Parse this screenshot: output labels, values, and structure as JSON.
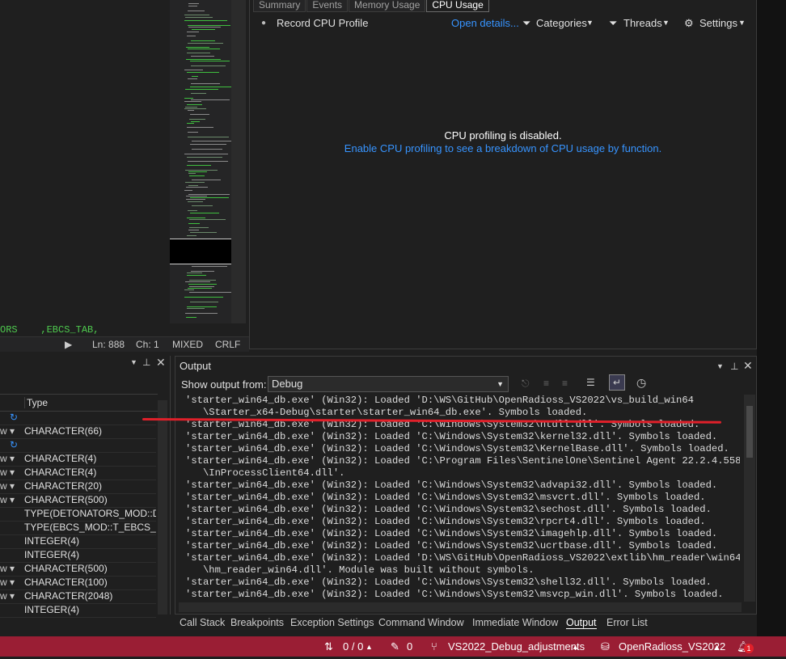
{
  "editor": {
    "code_snippet": "ORS    ,EBCS_TAB,",
    "status": {
      "ln": "Ln: 888",
      "ch": "Ch: 1",
      "indent": "MIXED",
      "eol": "CRLF"
    }
  },
  "diagnostics": {
    "tabs": [
      "Summary",
      "Events",
      "Memory Usage",
      "CPU Usage"
    ],
    "active_tab": "CPU Usage",
    "toolbar": {
      "record": "Record CPU Profile",
      "open_details": "Open details...",
      "categories": "Categories",
      "threads": "Threads",
      "settings": "Settings"
    },
    "message": "CPU profiling is disabled.",
    "link": "Enable CPU profiling to see a breakdown of CPU usage by function."
  },
  "locals": {
    "column_type": "Type",
    "rows": [
      {
        "a": "",
        "type": ""
      },
      {
        "a": "w",
        "type": "CHARACTER(66)"
      },
      {
        "a": "",
        "type": ""
      },
      {
        "a": "w",
        "type": "CHARACTER(4)"
      },
      {
        "a": "w",
        "type": "CHARACTER(4)"
      },
      {
        "a": "w",
        "type": "CHARACTER(20)"
      },
      {
        "a": "w",
        "type": "CHARACTER(500)"
      },
      {
        "a": "",
        "type": "TYPE(DETONATORS_MOD::D..."
      },
      {
        "a": "",
        "type": "TYPE(EBCS_MOD::T_EBCS_TA..."
      },
      {
        "a": "",
        "type": "INTEGER(4)"
      },
      {
        "a": "",
        "type": "INTEGER(4)"
      },
      {
        "a": "w",
        "type": "CHARACTER(500)"
      },
      {
        "a": "w",
        "type": "CHARACTER(100)"
      },
      {
        "a": "w",
        "type": "CHARACTER(2048)"
      },
      {
        "a": "",
        "type": "INTEGER(4)"
      }
    ]
  },
  "output": {
    "title": "Output",
    "show_from_label": "Show output from:",
    "source": "Debug",
    "lines": [
      "'starter_win64_db.exe' (Win32): Loaded 'D:\\WS\\GitHub\\OpenRadioss_VS2022\\vs_build_win64",
      "   \\Starter_x64-Debug\\starter\\starter_win64_db.exe'. Symbols loaded.",
      "'starter_win64_db.exe' (Win32): Loaded 'C:\\Windows\\System32\\ntdll.dll'. Symbols loaded.",
      "'starter_win64_db.exe' (Win32): Loaded 'C:\\Windows\\System32\\kernel32.dll'. Symbols loaded.",
      "'starter_win64_db.exe' (Win32): Loaded 'C:\\Windows\\System32\\KernelBase.dll'. Symbols loaded.",
      "'starter_win64_db.exe' (Win32): Loaded 'C:\\Program Files\\SentinelOne\\Sentinel Agent 22.2.4.558",
      "   \\InProcessClient64.dll'.",
      "'starter_win64_db.exe' (Win32): Loaded 'C:\\Windows\\System32\\advapi32.dll'. Symbols loaded.",
      "'starter_win64_db.exe' (Win32): Loaded 'C:\\Windows\\System32\\msvcrt.dll'. Symbols loaded.",
      "'starter_win64_db.exe' (Win32): Loaded 'C:\\Windows\\System32\\sechost.dll'. Symbols loaded.",
      "'starter_win64_db.exe' (Win32): Loaded 'C:\\Windows\\System32\\rpcrt4.dll'. Symbols loaded.",
      "'starter_win64_db.exe' (Win32): Loaded 'C:\\Windows\\System32\\imagehlp.dll'. Symbols loaded.",
      "'starter_win64_db.exe' (Win32): Loaded 'C:\\Windows\\System32\\ucrtbase.dll'. Symbols loaded.",
      "'starter_win64_db.exe' (Win32): Loaded 'D:\\WS\\GitHub\\OpenRadioss_VS2022\\extlib\\hm_reader\\win64",
      "   \\hm_reader_win64.dll'. Module was built without symbols.",
      "'starter_win64_db.exe' (Win32): Loaded 'C:\\Windows\\System32\\shell32.dll'. Symbols loaded.",
      "'starter_win64_db.exe' (Win32): Loaded 'C:\\Windows\\System32\\msvcp_win.dll'. Symbols loaded."
    ]
  },
  "bottom_tabs": [
    "Call Stack",
    "Breakpoints",
    "Exception Settings",
    "Command Window",
    "Immediate Window",
    "Output",
    "Error List"
  ],
  "active_bottom_tab": "Output",
  "statusbar": {
    "errors": "0 / 0",
    "edits": "0",
    "branch": "VS2022_Debug_adjustments",
    "repo": "OpenRadioss_VS2022",
    "notifications": "1"
  },
  "colors": {
    "statusbar": "#9a1e34",
    "link": "#3794ff",
    "annotation": "#e0202a"
  }
}
